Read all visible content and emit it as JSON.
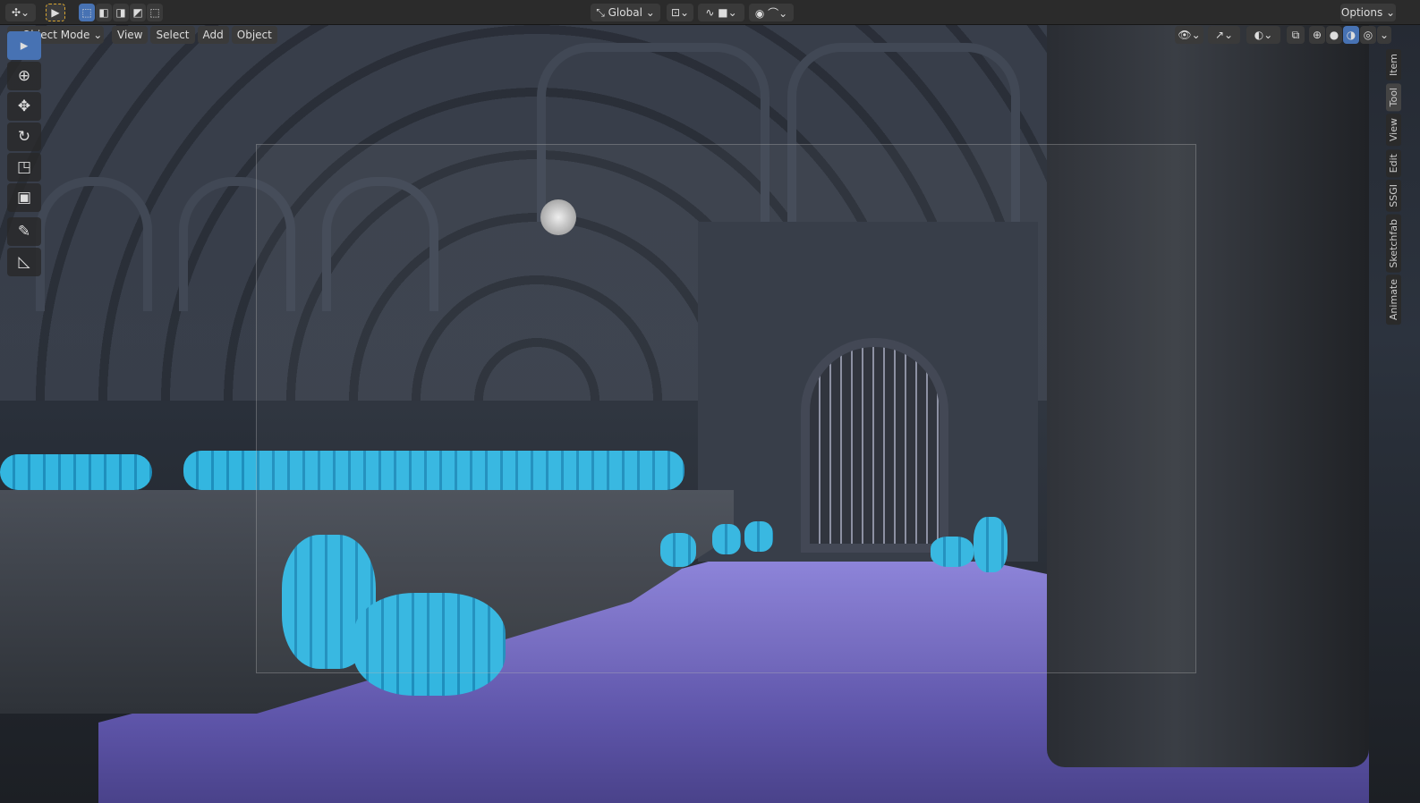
{
  "topbar": {
    "transform_orientation": "Global",
    "options_label": "Options"
  },
  "header": {
    "mode": "Object Mode",
    "menus": [
      "View",
      "Select",
      "Add",
      "Object"
    ]
  },
  "tools": [
    {
      "name": "select-box-tool",
      "icon": "▸",
      "active": true
    },
    {
      "name": "cursor-tool",
      "icon": "⊕"
    },
    {
      "name": "move-tool",
      "icon": "✥"
    },
    {
      "name": "rotate-tool",
      "icon": "↻"
    },
    {
      "name": "scale-tool",
      "icon": "◳"
    },
    {
      "name": "transform-tool",
      "icon": "▣"
    },
    {
      "name": "annotate-tool",
      "icon": "✎"
    },
    {
      "name": "measure-tool",
      "icon": "◺"
    }
  ],
  "sidebar_tabs": [
    "Item",
    "Tool",
    "View",
    "Edit",
    "SSGI",
    "Sketchfab",
    "Animate"
  ],
  "colors": {
    "accent": "#4772b3",
    "floor": "#8a80d8",
    "barrel": "#33b6e0"
  }
}
